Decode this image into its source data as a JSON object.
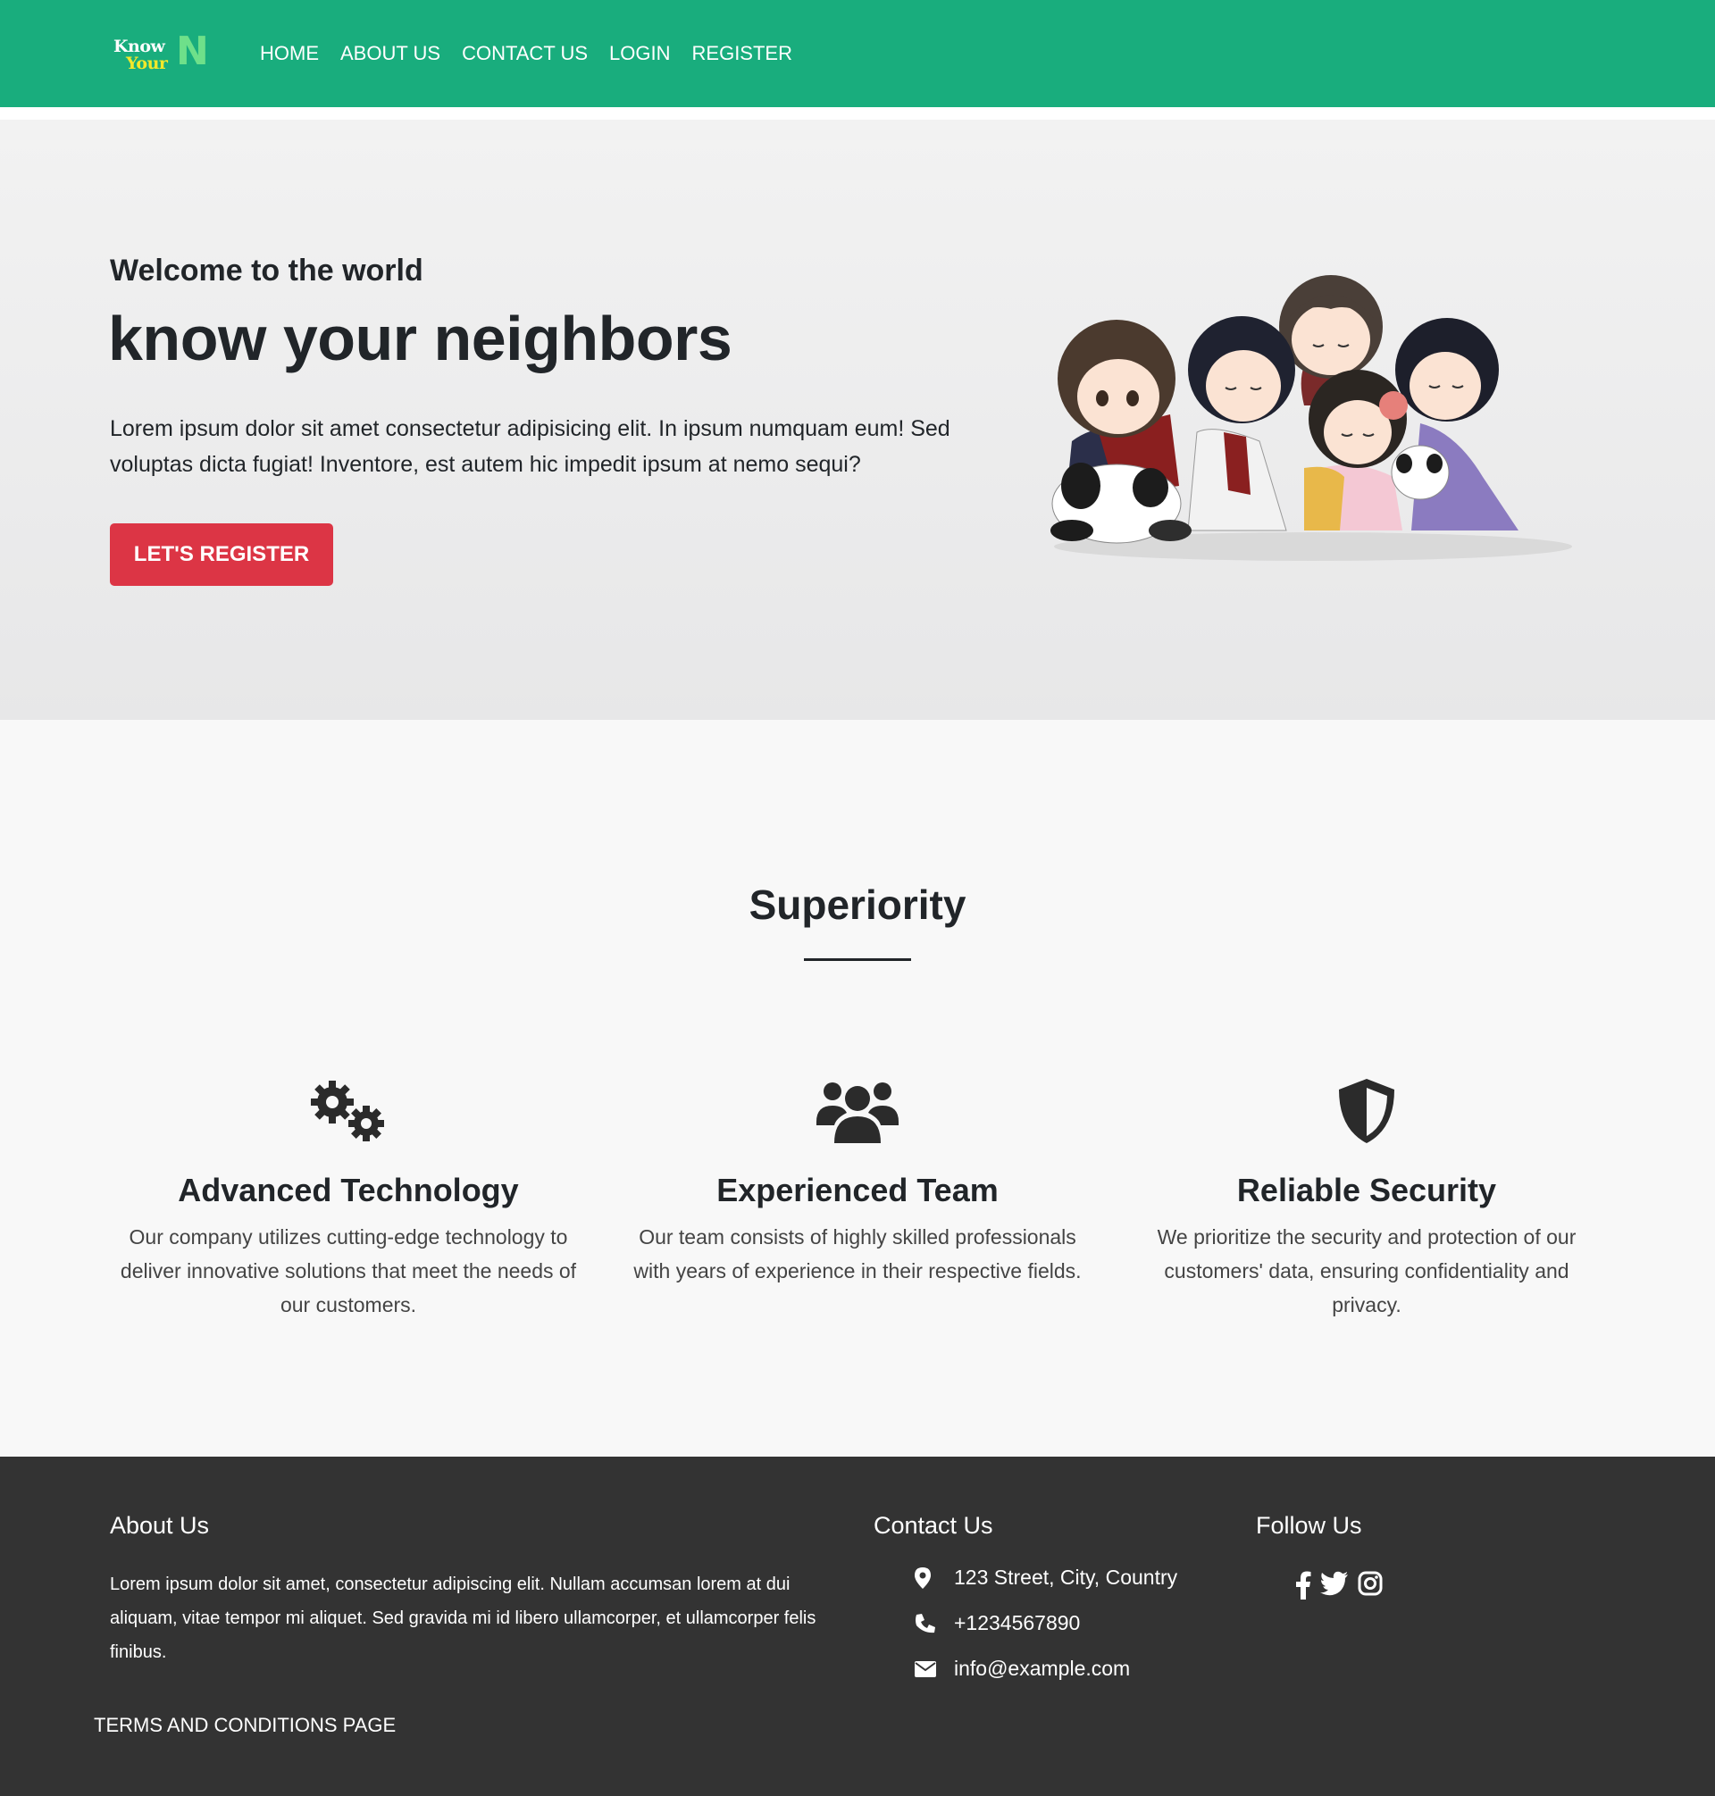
{
  "brand": {
    "line1": "Know",
    "line2": "Your",
    "mark": "N"
  },
  "nav": {
    "items": [
      "HOME",
      "ABOUT US",
      "CONTACT US",
      "LOGIN",
      "REGISTER"
    ]
  },
  "hero": {
    "pre_title": "Welcome to the world",
    "title": "know your neighbors",
    "text": "Lorem ipsum dolor sit amet consectetur adipisicing elit. In ipsum numquam eum! Sed voluptas dicta fugiat! Inventore, est autem hic impedit ipsum at nemo sequi?",
    "button": "LET'S REGISTER",
    "image": "chibi-neighbors-group-illustration"
  },
  "features": {
    "title": "Superiority",
    "items": [
      {
        "icon": "gears-icon",
        "title": "Advanced Technology",
        "text": "Our company utilizes cutting-edge technology to deliver innovative solutions that meet the needs of our customers."
      },
      {
        "icon": "users-icon",
        "title": "Experienced Team",
        "text": "Our team consists of highly skilled professionals with years of experience in their respective fields."
      },
      {
        "icon": "shield-icon",
        "title": "Reliable Security",
        "text": "We prioritize the security and protection of our customers' data, ensuring confidentiality and privacy."
      }
    ]
  },
  "footer": {
    "about_title": "About Us",
    "about_text": "Lorem ipsum dolor sit amet, consectetur adipiscing elit. Nullam accumsan lorem at dui aliquam, vitae tempor mi aliquet. Sed gravida mi id libero ullamcorper, et ullamcorper felis finibus.",
    "contact_title": "Contact Us",
    "address": "123 Street, City, Country",
    "phone": "+1234567890",
    "email": "info@example.com",
    "follow_title": "Follow Us",
    "social": [
      "facebook-icon",
      "twitter-icon",
      "instagram-icon"
    ],
    "terms": "TERMS AND CONDITIONS PAGE"
  },
  "colors": {
    "navbar": "#19ad7d",
    "accent_button": "#dc3545",
    "footer": "#333333",
    "text": "#212529"
  }
}
